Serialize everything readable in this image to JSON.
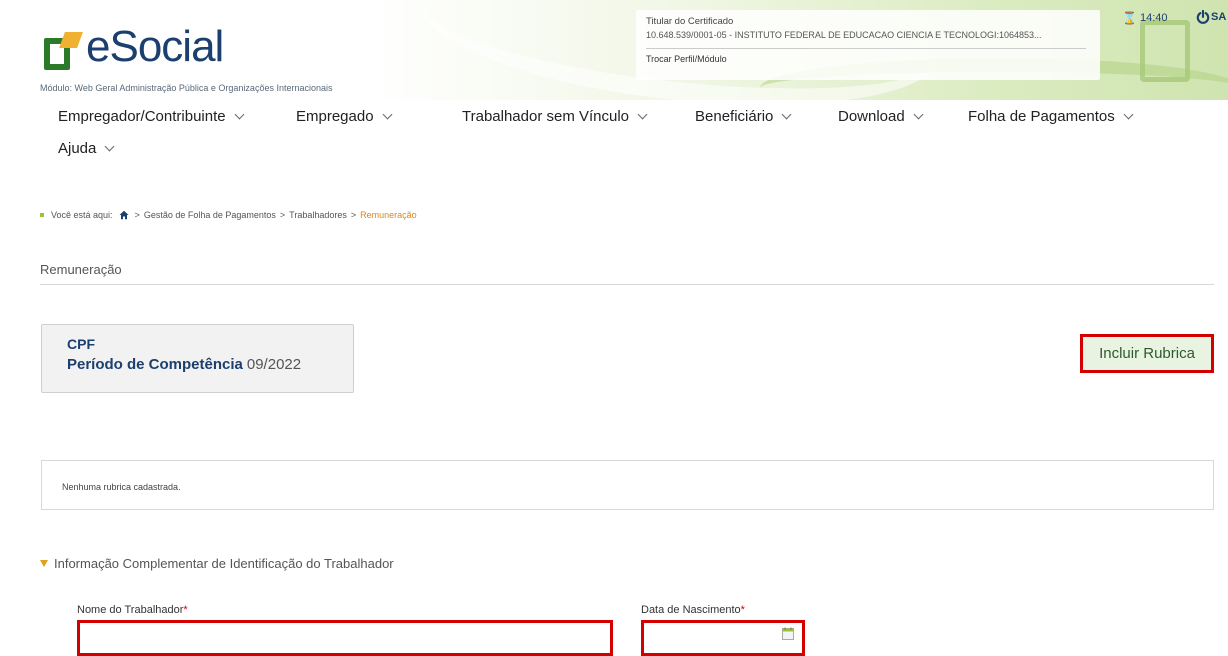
{
  "header": {
    "logo_text": "eSocial",
    "module": "Módulo: Web Geral Administração Pública e Organizações Internacionais",
    "certificate_title": "Titular do Certificado",
    "certificate_value": "10.648.539/0001-05 - INSTITUTO FEDERAL DE EDUCACAO CIENCIA E TECNOLOGI:1064853...",
    "switch_profile": "Trocar Perfil/Módulo",
    "time": "14:40",
    "user_short": "SA"
  },
  "menu": {
    "items": [
      {
        "label": "Empregador/Contribuinte"
      },
      {
        "label": "Empregado"
      },
      {
        "label": "Trabalhador sem Vínculo"
      },
      {
        "label": "Beneficiário"
      },
      {
        "label": "Download"
      },
      {
        "label": "Folha de Pagamentos"
      },
      {
        "label": "Ajuda"
      }
    ]
  },
  "breadcrumb": {
    "prefix": "Você está aqui:",
    "sep": ">",
    "items": [
      "Gestão de Folha de Pagamentos",
      "Trabalhadores"
    ],
    "current": "Remuneração"
  },
  "page": {
    "title": "Remuneração"
  },
  "card": {
    "cpf_label": "CPF",
    "period_label": "Período de Competência",
    "period_value": "09/2022"
  },
  "actions": {
    "incluir_rubrica": "Incluir Rubrica"
  },
  "rubricas": {
    "empty_message": "Nenhuma rubrica cadastrada."
  },
  "section": {
    "title": "Informação Complementar de Identificação do Trabalhador",
    "name_label": "Nome do Trabalhador",
    "name_value": "",
    "birth_label": "Data de Nascimento",
    "birth_value": "",
    "required_mark": "*"
  },
  "colors": {
    "brand_blue": "#1b3f6e",
    "accent_green": "#9bc23c",
    "highlight_red": "#d40000",
    "breadcrumb_current": "#d98a1c"
  }
}
